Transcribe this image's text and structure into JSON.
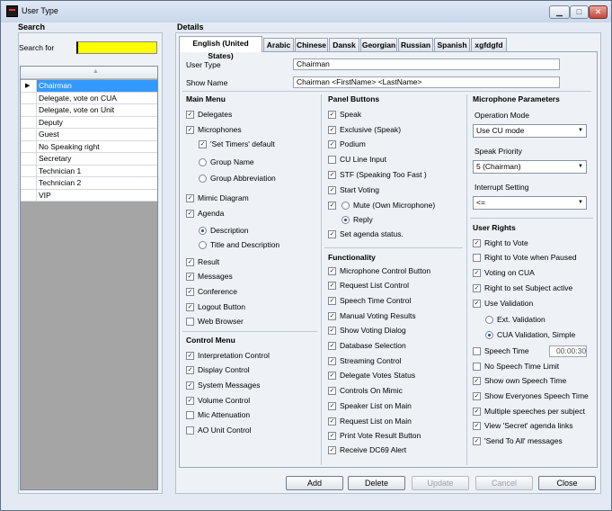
{
  "window": {
    "title": "User Type",
    "minimize": "▁",
    "maximize": "□",
    "close": "✕"
  },
  "search": {
    "group": "Search",
    "label": "Search for",
    "value": ""
  },
  "list": {
    "items": [
      "Chairman",
      "Delegate, vote on CUA",
      "Delegate, vote on Unit",
      "Deputy",
      "Guest",
      "No Speaking right",
      "Secretary",
      "Technician 1",
      "Technician 2",
      "VIP"
    ],
    "selected": "Chairman"
  },
  "details": {
    "group": "Details"
  },
  "tabs": [
    "English (United States)",
    "Arabic",
    "Chinese",
    "Dansk",
    "Georgian",
    "Russian",
    "Spanish",
    "xgfdgfd"
  ],
  "form": {
    "user_type_label": "User Type",
    "user_type_value": "Chairman",
    "show_name_label": "Show Name",
    "show_name_value": "Chairman <FirstName> <LastName>"
  },
  "main_menu": {
    "title": "Main Menu",
    "items": [
      {
        "label": "Delegates",
        "checked": true
      },
      {
        "label": "Microphones",
        "checked": true
      },
      {
        "label": "'Set Timers' default",
        "checked": true
      },
      {
        "label": "Group Name",
        "radio": false
      },
      {
        "label": "Group Abbreviation",
        "radio": false
      },
      {
        "label": "Mimic Diagram",
        "checked": true
      },
      {
        "label": "Agenda",
        "checked": true
      },
      {
        "label": "Description",
        "radio": true
      },
      {
        "label": "Title and Description",
        "radio": false
      },
      {
        "label": "Result",
        "checked": true
      },
      {
        "label": "Messages",
        "checked": true
      },
      {
        "label": "Conference",
        "checked": true
      },
      {
        "label": "Logout Button",
        "checked": true
      },
      {
        "label": "Web Browser",
        "checked": false
      }
    ]
  },
  "control_menu": {
    "title": "Control Menu",
    "items": [
      {
        "label": "Interpretation Control",
        "checked": true
      },
      {
        "label": "Display Control",
        "checked": true
      },
      {
        "label": "System Messages",
        "checked": true
      },
      {
        "label": "Volume Control",
        "checked": true
      },
      {
        "label": "Mic Attenuation",
        "checked": false
      },
      {
        "label": "AO Unit Control",
        "checked": false
      }
    ]
  },
  "panel_buttons": {
    "title": "Panel Buttons",
    "items": [
      {
        "label": "Speak",
        "checked": true
      },
      {
        "label": "Exclusive (Speak)",
        "checked": true
      },
      {
        "label": "Podium",
        "checked": true
      },
      {
        "label": "CU Line Input",
        "checked": false
      },
      {
        "label": "STF (Speaking Too Fast )",
        "checked": true
      },
      {
        "label": "Start Voting",
        "checked": true
      },
      {
        "label": "Mute (Own Microphone)",
        "checked": true,
        "radio": false
      },
      {
        "label": "Reply",
        "radio": true
      },
      {
        "label": "Set agenda status.",
        "checked": true
      }
    ]
  },
  "functionality": {
    "title": "Functionality",
    "items": [
      {
        "label": "Microphone Control Button",
        "checked": true
      },
      {
        "label": "Request List Control",
        "checked": true
      },
      {
        "label": "Speech Time Control",
        "checked": true
      },
      {
        "label": "Manual Voting Results",
        "checked": true
      },
      {
        "label": "Show Voting Dialog",
        "checked": true
      },
      {
        "label": "Database Selection",
        "checked": true
      },
      {
        "label": "Streaming Control",
        "checked": true
      },
      {
        "label": "Delegate Votes Status",
        "checked": true
      },
      {
        "label": "Controls On Mimic",
        "checked": true
      },
      {
        "label": "Speaker List on Main",
        "checked": true
      },
      {
        "label": "Request List on Main",
        "checked": true
      },
      {
        "label": "Print Vote Result Button",
        "checked": true
      },
      {
        "label": "Receive DC69 Alert",
        "checked": true
      }
    ]
  },
  "mic_params": {
    "title": "Microphone Parameters",
    "operation_mode_label": "Operation Mode",
    "operation_mode_value": "Use CU mode",
    "speak_priority_label": "Speak Priority",
    "speak_priority_value": "5 (Chairman)",
    "interrupt_label": "Interrupt Setting",
    "interrupt_value": "<="
  },
  "user_rights": {
    "title": "User Rights",
    "items": [
      {
        "label": "Right to Vote",
        "checked": true
      },
      {
        "label": "Right to Vote when Paused",
        "checked": false
      },
      {
        "label": "Voting on CUA",
        "checked": true
      },
      {
        "label": "Right to set Subject active",
        "checked": true
      },
      {
        "label": "Use Validation",
        "checked": true
      },
      {
        "label": "Ext. Validation",
        "radio": false
      },
      {
        "label": "CUA Validation, Simple",
        "radio": true
      },
      {
        "label": "Speech Time",
        "checked": false
      },
      {
        "label": "No Speech Time Limit",
        "checked": false
      },
      {
        "label": "Show own Speech Time",
        "checked": true
      },
      {
        "label": "Show Everyones Speech Time",
        "checked": true
      },
      {
        "label": "Multiple speeches per subject",
        "checked": true
      },
      {
        "label": "View 'Secret' agenda links",
        "checked": true
      },
      {
        "label": "'Send To All' messages",
        "checked": true
      }
    ],
    "speech_time_value": "00:00:30"
  },
  "buttons": {
    "add": "Add",
    "delete": "Delete",
    "update": "Update",
    "cancel": "Cancel",
    "close": "Close"
  },
  "icons": {
    "row_pointer": "▶",
    "sort": "▲",
    "check": "✓",
    "dropdown": "▼"
  }
}
